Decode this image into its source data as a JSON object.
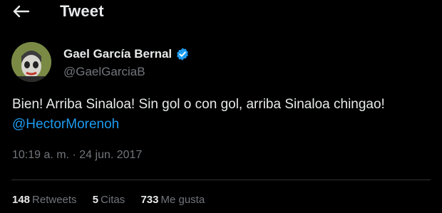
{
  "header": {
    "title": "Tweet",
    "back_icon": "arrow-left-icon"
  },
  "author": {
    "display_name": "Gael García Bernal",
    "handle": "@GaelGarciaB",
    "verified": true,
    "verified_color": "#1d9bf0"
  },
  "tweet": {
    "text": "Bien! Arriba Sinaloa! Sin gol o con gol, arriba Sinaloa chingao!",
    "mention": "@HectorMorenoh",
    "timestamp": "10:19 a. m. · 24 jun. 2017"
  },
  "stats": [
    {
      "count": "148",
      "label": "Retweets"
    },
    {
      "count": "5",
      "label": "Citas"
    },
    {
      "count": "733",
      "label": "Me gusta"
    }
  ],
  "colors": {
    "background": "#000000",
    "text": "#e7e9ea",
    "secondary": "#71767b",
    "link": "#1d9bf0",
    "divider": "#2f3336"
  }
}
